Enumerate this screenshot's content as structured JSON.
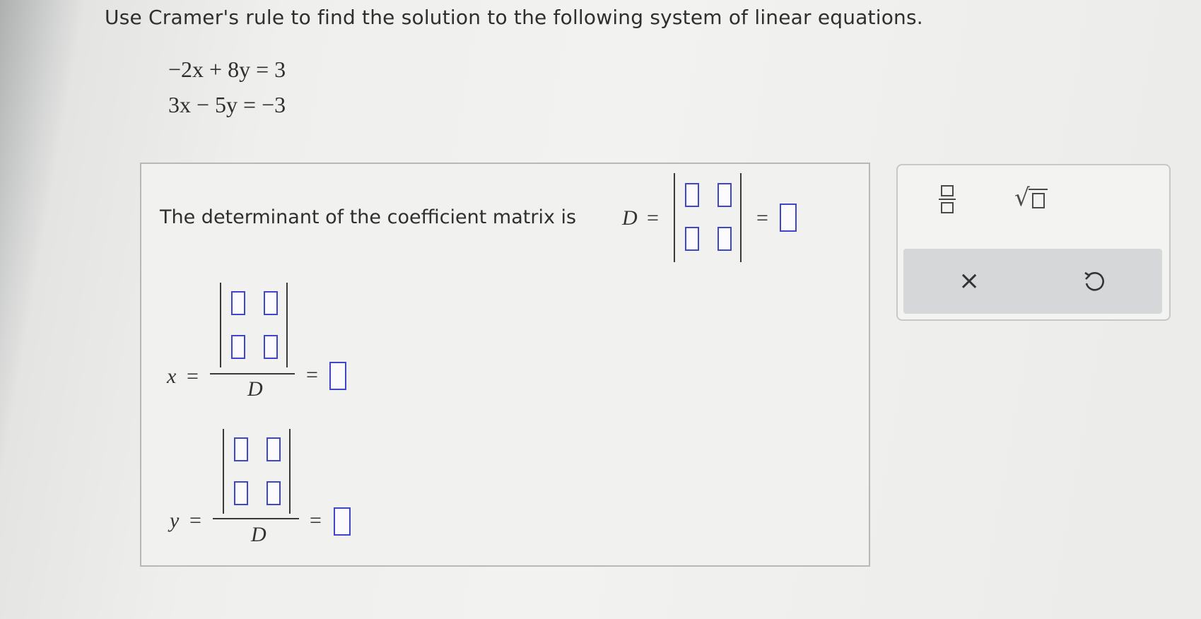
{
  "question": {
    "prompt": "Use Cramer's rule to find the solution to the following system of linear equations.",
    "equations": [
      "−2x + 8y = 3",
      "3x − 5y = −3"
    ]
  },
  "answer": {
    "determinant_label": "The determinant of the coefficient matrix is",
    "D_symbol": "D",
    "equals": "=",
    "x_symbol": "x",
    "y_symbol": "y",
    "denominator": "D"
  },
  "toolbar": {
    "fraction": "fraction",
    "sqrt_symbol": "√",
    "clear_symbol": "×",
    "undo": "undo"
  },
  "colors": {
    "slot_border": "#3f47c8",
    "toolbar_bg": "#f3f3f1",
    "actions_bg": "#d6d7d8"
  }
}
